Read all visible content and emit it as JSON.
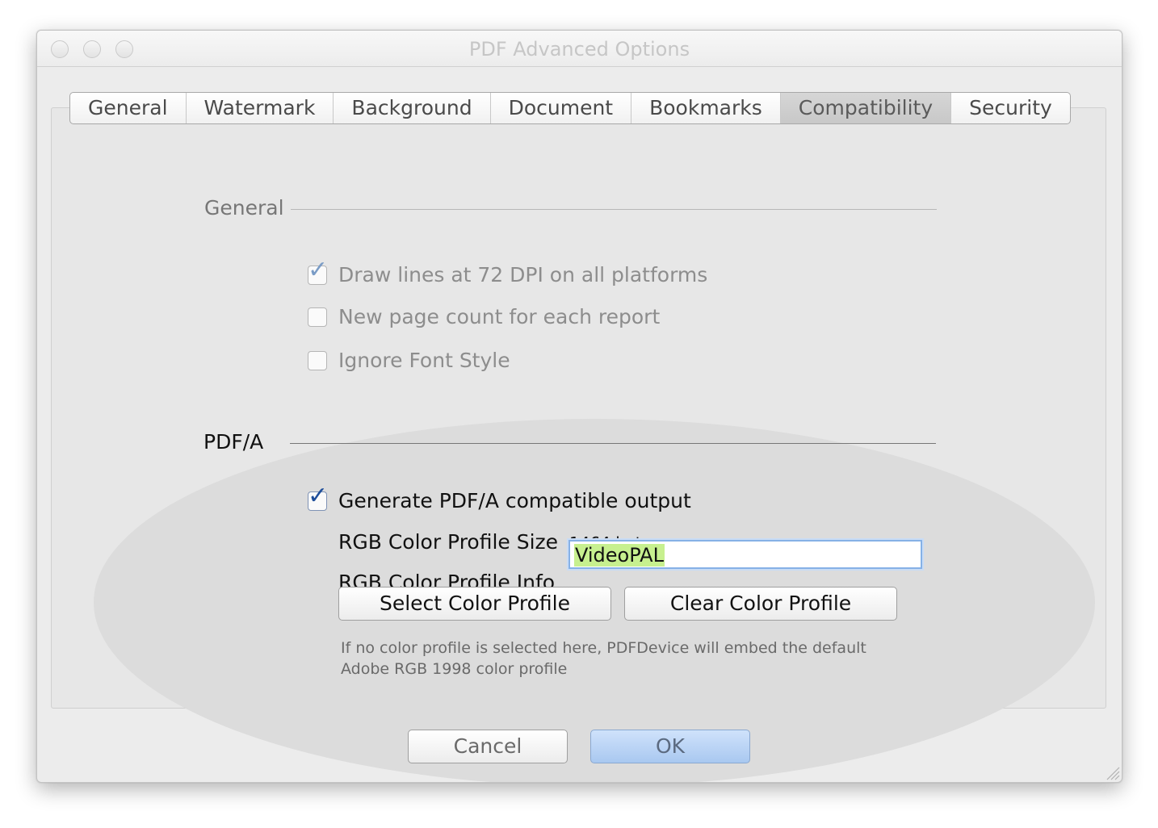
{
  "window": {
    "title": "PDF Advanced Options"
  },
  "tabs": [
    {
      "label": "General",
      "selected": false
    },
    {
      "label": "Watermark",
      "selected": false
    },
    {
      "label": "Background",
      "selected": false
    },
    {
      "label": "Document",
      "selected": false
    },
    {
      "label": "Bookmarks",
      "selected": false
    },
    {
      "label": "Compatibility",
      "selected": true
    },
    {
      "label": "Security",
      "selected": false
    }
  ],
  "general_section": {
    "title": "General",
    "options": [
      {
        "label": "Draw lines at 72 DPI on all platforms",
        "checked": true
      },
      {
        "label": "New page count for each report",
        "checked": false
      },
      {
        "label": "Ignore Font Style",
        "checked": false
      }
    ]
  },
  "pdfa_section": {
    "title": "PDF/A",
    "generate": {
      "label": "Generate PDF/A compatible output",
      "checked": true
    },
    "profile_size_label": "RGB Color Profile Size",
    "profile_size_value": "1464 bytes",
    "profile_info_label": "RGB Color Profile Info",
    "profile_info_value": "VideoPAL",
    "select_button": "Select Color Profile",
    "clear_button": "Clear Color Profile",
    "note_line1": "If no color profile is selected here, PDFDevice will embed the default",
    "note_line2": "Adobe RGB 1998 color profile"
  },
  "footer": {
    "cancel_label": "Cancel",
    "ok_label": "OK"
  },
  "colors": {
    "check_dim": "#7a9cc6",
    "check_active": "#1e4e9a",
    "field_highlight": "#c7f08f",
    "default_button": "#a9c8f0"
  },
  "icons": {
    "check": "checkmark-icon",
    "resize": "resize-grip-icon"
  }
}
